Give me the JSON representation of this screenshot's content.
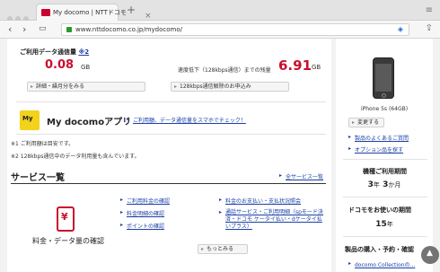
{
  "browser": {
    "tab_title": "My docomo | NTTドコモ",
    "tab_close": "×",
    "new_tab": "+",
    "url": "www.nttdocomo.co.jp/mydocomo/",
    "nav": {
      "back": "‹",
      "forward": "›",
      "sidebar": "▭"
    }
  },
  "usage": {
    "title": "ご利用データ通信量",
    "note": "※2",
    "used_value": "0.08",
    "used_unit": "GB",
    "remain_label": "速度低下（128kbps通信）までの残量",
    "remain_value": "6.91",
    "remain_unit": "GB",
    "btn_detail": "詳細・繰月分をみる",
    "btn_128": "128kbps通信解除のお申込み"
  },
  "myapp": {
    "logo_text": "My",
    "title": "My docomoアプリ",
    "link": "ご利用額、データ通信量をスマホでチェック！"
  },
  "notes": {
    "n1": "※1 ご利用額は目安です。",
    "n2": "※2 128kbps通信中のデータ利用量も含んでいます。"
  },
  "services": {
    "title": "サービス一覧",
    "all_link": "全サービス一覧",
    "fee_icon": "¥",
    "fee_label": "料金・データ量の確認",
    "left_links": [
      "ご利用料金の確認",
      "料金明細の確認",
      "ポイントの確認"
    ],
    "right_links": [
      "料金のお支払い・支払状況照会",
      "通話サービス・ご利用明細（spモード決済・ドコモ ケータイ払い・dケータイ払いプラス）"
    ],
    "more_btn": "もっとみる"
  },
  "sidebar": {
    "device_name": "iPhone 5s (64GB)",
    "change_btn": "変更する",
    "links": [
      "製品のよくあるご質問",
      "オプション品を探す"
    ],
    "period_title": "機種ご利用期間",
    "period_years": "3",
    "period_years_unit": "年",
    "period_months": "3",
    "period_months_unit": "か月",
    "docomo_title": "ドコモをお使いの期間",
    "docomo_years": "15",
    "docomo_years_unit": "年",
    "purchase_title": "製品の購入・予約・確認",
    "collection_link": "docomo Collectionの..."
  }
}
